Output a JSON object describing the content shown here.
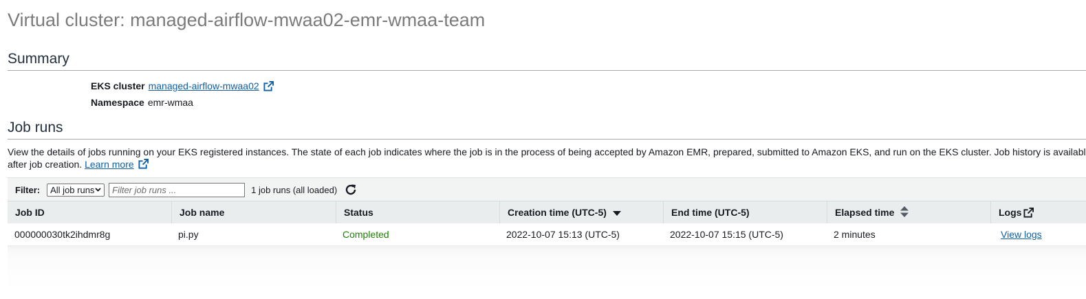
{
  "page": {
    "title": "Virtual cluster: managed-airflow-mwaa02-emr-wmaa-team"
  },
  "summary": {
    "heading": "Summary",
    "eks_cluster_label": "EKS cluster",
    "eks_cluster_value": "managed-airflow-mwaa02",
    "namespace_label": "Namespace",
    "namespace_value": "emr-wmaa"
  },
  "job_runs": {
    "heading": "Job runs",
    "description_line1": "View the details of jobs running on your EKS registered instances. The state of each job indicates where the job is in the process of being accepted by Amazon EMR, prepared, submitted to Amazon EKS, and run on the EKS cluster. Job history is availabl",
    "description_line2_prefix": "after job creation. ",
    "learn_more": "Learn more"
  },
  "filter": {
    "label": "Filter:",
    "selected_option": "All job runs",
    "placeholder": "Filter job runs ...",
    "count_text": "1 job runs (all loaded)"
  },
  "table": {
    "columns": [
      "Job ID",
      "Job name",
      "Status",
      "Creation time (UTC-5)",
      "End time (UTC-5)",
      "Elapsed time",
      "Logs"
    ],
    "rows": [
      {
        "job_id": "000000030tk2ihdmr8g",
        "job_name": "pi.py",
        "status": "Completed",
        "creation_time": "2022-10-07 15:13 (UTC-5)",
        "end_time": "2022-10-07 15:15 (UTC-5)",
        "elapsed_time": "2 minutes",
        "logs": "View logs"
      }
    ]
  },
  "icons": {
    "external_link": "external-link-icon",
    "refresh": "refresh-icon",
    "sort_desc": "sort-descending-icon",
    "sort_both": "sort-both-icon",
    "dropdown": "chevron-down-icon"
  },
  "colors": {
    "link": "#0f5fa5",
    "status_completed": "#1d8102",
    "title_gray": "#7b7b7b",
    "header_bg": "#eaeded",
    "filter_bg": "#f2f3f3"
  }
}
